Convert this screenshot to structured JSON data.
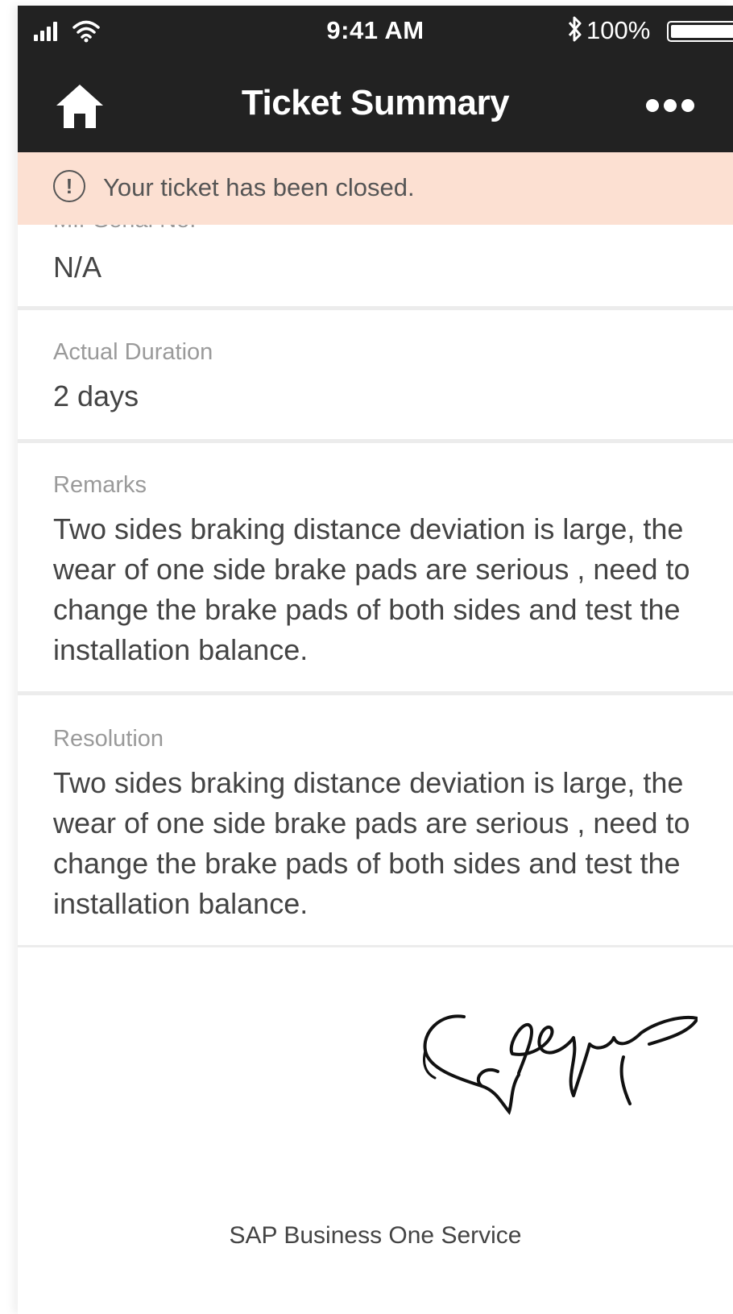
{
  "status_bar": {
    "time": "9:41 AM",
    "battery": "100%",
    "signal_icon": "signal-bars-icon",
    "wifi_icon": "wifi-icon",
    "bluetooth_icon": "bluetooth-icon",
    "battery_icon": "battery-icon"
  },
  "navbar": {
    "title": "Ticket Summary",
    "home_icon": "home-icon",
    "more_icon": "more-icon"
  },
  "banner": {
    "text": "Your ticket has been closed.",
    "icon": "info-alert-icon",
    "background": "#fce0d2"
  },
  "fields": {
    "partial_label": "Mfr Serial No.",
    "serial_value": "N/A",
    "duration_label": "Actual Duration",
    "duration_value": "2 days",
    "remarks_label": "Remarks",
    "remarks_value": "Two sides braking distance deviation is large, the wear of one side brake pads are serious , need to change the brake pads of both sides and test the installation balance.",
    "resolution_label": "Resolution",
    "resolution_value": "Two sides braking distance deviation is large, the wear of one side brake pads are serious , need to change the brake pads of both sides and test the installation balance."
  },
  "signature": {
    "description": "handwritten-signature"
  },
  "footer": {
    "text": "SAP Business One Service"
  },
  "colors": {
    "header": "#222222",
    "label": "#9a9a9a",
    "value": "#444444",
    "divider": "#ececec"
  }
}
